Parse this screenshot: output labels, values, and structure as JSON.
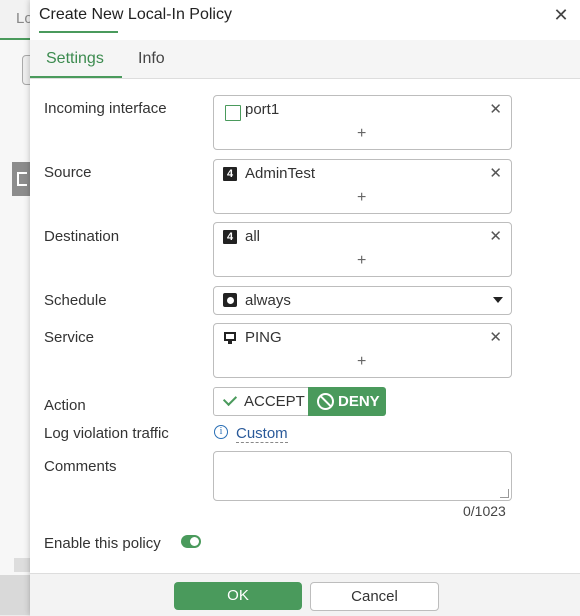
{
  "background": {
    "tab_partial": "Lo"
  },
  "dialog": {
    "title": "Create New Local-In Policy",
    "close_icon": "close-icon"
  },
  "tabs": [
    {
      "label": "Settings",
      "active": true
    },
    {
      "label": "Info",
      "active": false
    }
  ],
  "form": {
    "incoming_interface": {
      "label": "Incoming interface",
      "value": "port1",
      "icon": "port-icon"
    },
    "source": {
      "label": "Source",
      "value": "AdminTest",
      "icon": "address-icon"
    },
    "destination": {
      "label": "Destination",
      "value": "all",
      "icon": "address-icon"
    },
    "schedule": {
      "label": "Schedule",
      "value": "always",
      "icon": "schedule-icon"
    },
    "service": {
      "label": "Service",
      "value": "PING",
      "icon": "service-icon"
    },
    "action": {
      "label": "Action",
      "options": [
        "ACCEPT",
        "DENY"
      ],
      "selected": "DENY"
    },
    "log_violation": {
      "label": "Log violation traffic",
      "value": "Custom"
    },
    "comments": {
      "label": "Comments",
      "value": "",
      "counter": "0/1023"
    },
    "enable_policy": {
      "label": "Enable this policy",
      "enabled": true
    }
  },
  "address_badge": "4",
  "footer": {
    "ok_label": "OK",
    "cancel_label": "Cancel"
  },
  "colors": {
    "accent": "#4a9a5c",
    "link": "#2a5a9a"
  }
}
